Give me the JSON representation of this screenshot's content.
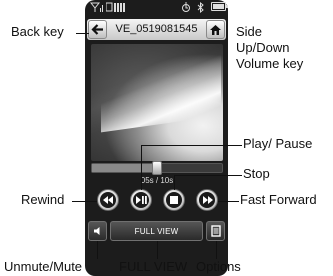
{
  "statusbar": {
    "signal_icon": "signal-bars-icon",
    "network_icon": "network-icon",
    "alarm_icon": "alarm-icon",
    "bluetooth_icon": "bluetooth-icon",
    "battery_icon": "battery-icon"
  },
  "titlebar": {
    "back_icon": "back-arrow-icon",
    "title": "VE_0519081545",
    "home_icon": "home-icon"
  },
  "player": {
    "timer": "05s / 10s",
    "progress": 0.5,
    "controls": [
      {
        "name": "rewind-button",
        "icon": "rewind-icon"
      },
      {
        "name": "play-pause-button",
        "icon": "play-pause-icon"
      },
      {
        "name": "stop-button",
        "icon": "stop-icon"
      },
      {
        "name": "fast-forward-button",
        "icon": "fast-forward-icon"
      }
    ]
  },
  "bottombar": {
    "mute_icon": "speaker-icon",
    "fullview_label": "FULL VIEW",
    "options_icon": "options-menu-icon"
  },
  "callouts": {
    "back_key": "Back key",
    "side_1": "Side",
    "side_2": "Up/Down",
    "side_3": "Volume key",
    "play_pause": "Play/ Pause",
    "stop": "Stop",
    "rewind": "Rewind",
    "fast_forward": "Fast Forward",
    "unmute_mute": "Unmute/Mute",
    "full_view": "FULL VIEW",
    "options": "Options"
  },
  "colors": {
    "phone_body": "#1c1c1c",
    "titlebar": "#e0e0e0",
    "controls": "#d2d2d2"
  }
}
